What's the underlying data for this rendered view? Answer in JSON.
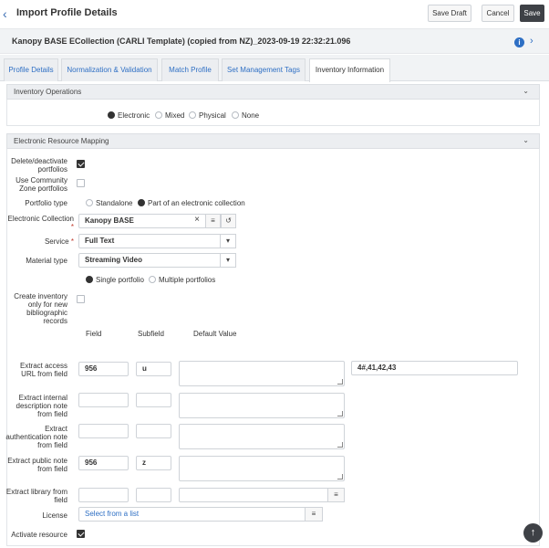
{
  "header": {
    "back_icon": "chevron-left-icon",
    "title": "Import Profile Details",
    "save_draft": "Save Draft",
    "cancel": "Cancel",
    "save": "Save"
  },
  "profile": {
    "name": "Kanopy BASE ECollection (CARLI Template) (copied from NZ)_2023-09-19 22:32:21.096"
  },
  "tabs": [
    {
      "label": "Profile Details"
    },
    {
      "label": "Normalization & Validation"
    },
    {
      "label": "Match Profile"
    },
    {
      "label": "Set Management Tags"
    },
    {
      "label": "Inventory Information"
    }
  ],
  "inventory_operations": {
    "title": "Inventory Operations",
    "options": [
      "Electronic",
      "Mixed",
      "Physical",
      "None"
    ],
    "selected": "Electronic"
  },
  "mapping": {
    "title": "Electronic Resource Mapping",
    "delete_deactivate": "Delete/deactivate portfolios",
    "use_community": "Use Community Zone portfolios",
    "portfolio_type_label": "Portfolio type",
    "portfolio_type_options": [
      "Standalone",
      "Part of an electronic collection"
    ],
    "electronic_collection_label": "Electronic Collection",
    "electronic_collection_value": "Kanopy BASE",
    "service_label": "Service",
    "service_value": "Full Text",
    "material_type_label": "Material type",
    "material_type_value": "Streaming Video",
    "portfolio_count_options": [
      "Single portfolio",
      "Multiple portfolios"
    ],
    "create_inventory_label": "Create inventory only for new bibliographic records",
    "col_field": "Field",
    "col_subfield": "Subfield",
    "col_default": "Default Value",
    "rows": [
      {
        "label": "Extract access URL from field",
        "field": "956",
        "subfield": "u",
        "extra": "4#,41,42,43"
      },
      {
        "label": "Extract internal description note from field",
        "field": "",
        "subfield": ""
      },
      {
        "label": "Extract authentication note from field",
        "field": "",
        "subfield": ""
      },
      {
        "label": "Extract public note from field",
        "field": "956",
        "subfield": "z"
      },
      {
        "label": "Extract library from field",
        "field": "",
        "subfield": ""
      }
    ],
    "license_label": "License",
    "license_value": "Select from a list",
    "activate_label": "Activate resource"
  }
}
